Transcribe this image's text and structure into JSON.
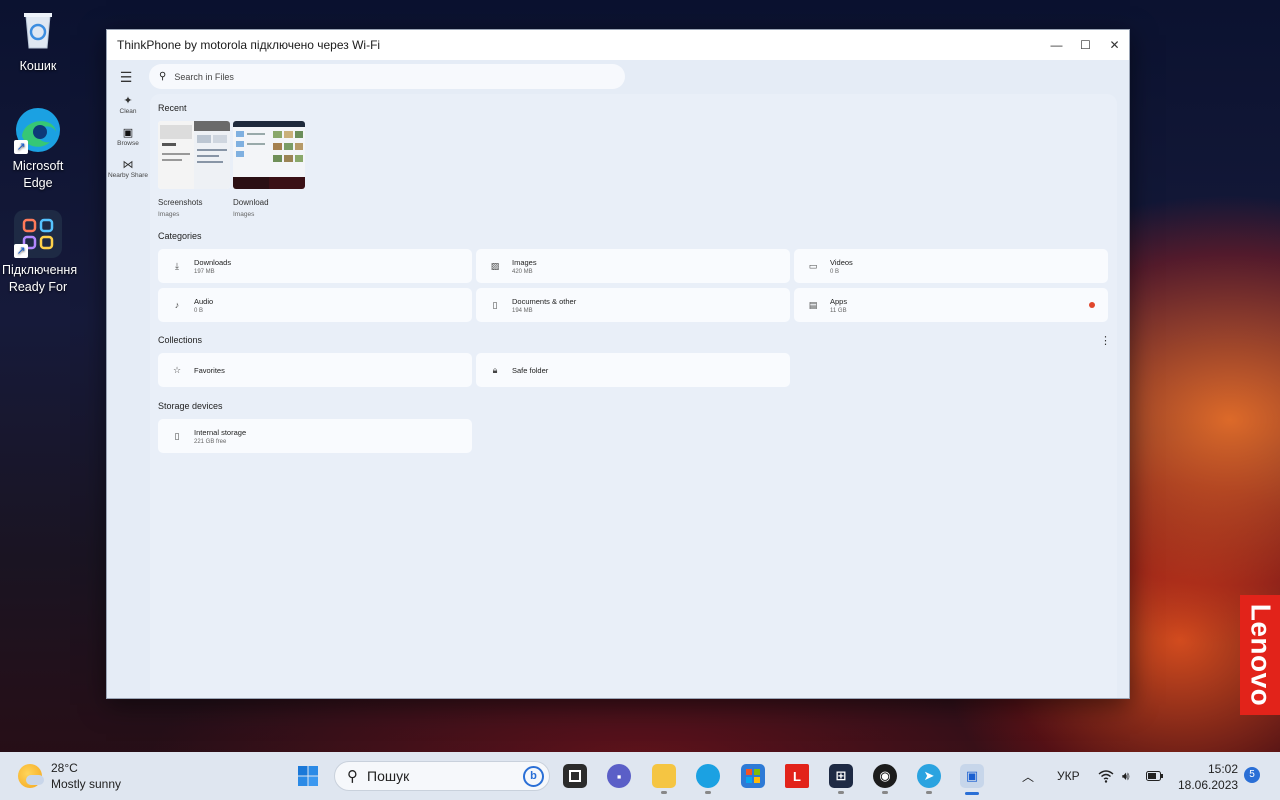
{
  "desktop": {
    "icons": [
      {
        "label": "Кошик",
        "icon": "recycle-bin-icon"
      },
      {
        "label": "Microsoft Edge",
        "icon": "edge-icon"
      },
      {
        "label": "Підключення Ready For",
        "icon": "ready-for-icon"
      }
    ],
    "brand": "Lenovo"
  },
  "window": {
    "title": "ThinkPhone by motorola підключено через Wi-Fi",
    "controls": {
      "minimize": "—",
      "maximize": "☐",
      "close": "✕"
    }
  },
  "files_app": {
    "search_placeholder": "Search in Files",
    "rail": [
      {
        "label": "Clean",
        "icon": "sparkle-icon"
      },
      {
        "label": "Browse",
        "icon": "browse-icon",
        "active": true
      },
      {
        "label": "Nearby Share",
        "icon": "nearby-share-icon"
      }
    ],
    "recent": {
      "title": "Recent",
      "items": [
        {
          "name": "Screenshots",
          "type": "Images"
        },
        {
          "name": "Download",
          "type": "Images"
        }
      ]
    },
    "categories": {
      "title": "Categories",
      "items": [
        {
          "label": "Downloads",
          "size": "197 MB",
          "icon": "download-icon"
        },
        {
          "label": "Images",
          "size": "420 MB",
          "icon": "image-icon"
        },
        {
          "label": "Videos",
          "size": "0 B",
          "icon": "video-icon"
        },
        {
          "label": "Audio",
          "size": "0 B",
          "icon": "music-note-icon"
        },
        {
          "label": "Documents & other",
          "size": "194 MB",
          "icon": "document-icon"
        },
        {
          "label": "Apps",
          "size": "11 GB",
          "icon": "apps-icon",
          "badge": true
        }
      ]
    },
    "collections": {
      "title": "Collections",
      "items": [
        {
          "label": "Favorites",
          "icon": "star-icon"
        },
        {
          "label": "Safe folder",
          "icon": "lock-icon"
        }
      ]
    },
    "storage": {
      "title": "Storage devices",
      "items": [
        {
          "label": "Internal storage",
          "sub": "221 GB free",
          "icon": "phone-icon"
        }
      ]
    }
  },
  "taskbar": {
    "weather": {
      "temp": "28°C",
      "desc": "Mostly sunny"
    },
    "search_placeholder": "Пошук",
    "apps": [
      "task-view-icon",
      "teams-icon",
      "file-explorer-icon",
      "edge-icon",
      "store-icon",
      "l-app-icon",
      "ready-for-icon",
      "camera-app-icon",
      "telegram-icon",
      "phone-link-icon"
    ],
    "lang": "УКР",
    "time": "15:02",
    "date": "18.06.2023",
    "notifications": "5"
  }
}
